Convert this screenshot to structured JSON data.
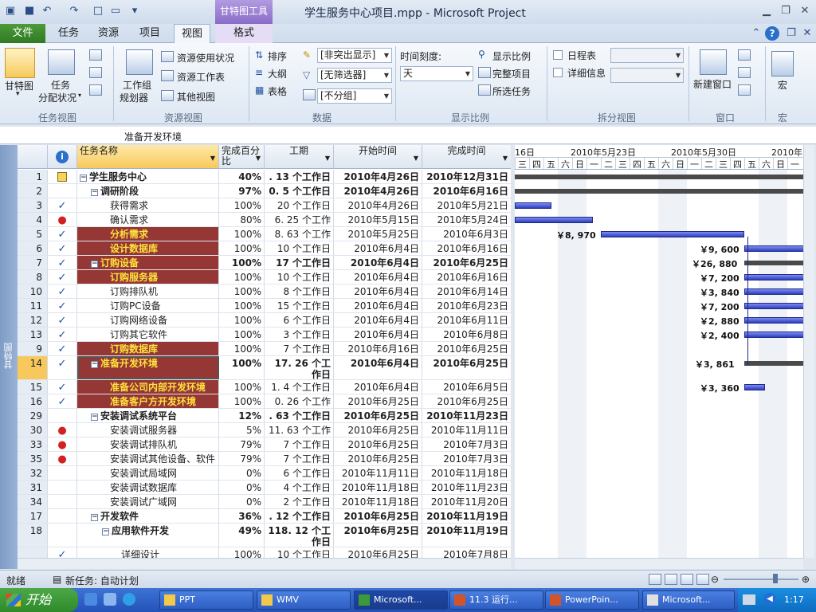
{
  "titlebar": {
    "title": "学生服务中心项目.mpp - Microsoft Project",
    "tool_tab_header": "甘特图工具"
  },
  "tabs": {
    "file": "文件",
    "items": [
      "任务",
      "资源",
      "项目",
      "视图",
      "格式"
    ],
    "active": "视图"
  },
  "ribbon": {
    "task_view": {
      "gantt": "甘特图",
      "task_usage_1": "任务",
      "task_usage_2": "分配状况",
      "group": "任务视图"
    },
    "resource_view": {
      "team_planner_1": "工作组",
      "team_planner_2": "规划器",
      "resource_usage": "资源使用状况",
      "resource_sheet": "资源工作表",
      "other_views": "其他视图",
      "group": "资源视图"
    },
    "data": {
      "sort": "排序",
      "outline": "大纲",
      "tables": "表格",
      "highlight": "[非突出显示]",
      "filter": "[无筛选器]",
      "group_by": "[不分组]",
      "group": "数据"
    },
    "zoom": {
      "timescale_label": "时间刻度:",
      "timescale_value": "天",
      "zoom": "显示比例",
      "entire_project": "完整项目",
      "selected_tasks": "所选任务",
      "group": "显示比例"
    },
    "split": {
      "timeline": "日程表",
      "details": "详细信息",
      "group": "拆分视图"
    },
    "window": {
      "new_window": "新建窗口",
      "group": "窗口"
    },
    "macros": {
      "macro": "宏",
      "group": "宏"
    }
  },
  "entry_bar": {
    "value": "准备开发环境"
  },
  "side_label": "甘特图",
  "table": {
    "headers": {
      "name": "任务名称",
      "pct": "完成百分比",
      "duration": "工期",
      "start": "开始时间",
      "finish": "完成时间"
    },
    "rows": [
      {
        "row": "1",
        "id": "1",
        "ind": "note",
        "name": "学生服务中心",
        "lvl": 0,
        "sum": true,
        "bold": true,
        "hl": false,
        "pct": "40%",
        "dur": ". 13 个工作日",
        "start": "2010年4月26日",
        "finish": "2010年12月31日"
      },
      {
        "row": "2",
        "id": "2",
        "ind": "",
        "name": "调研阶段",
        "lvl": 1,
        "sum": true,
        "bold": true,
        "hl": false,
        "pct": "97%",
        "dur": "0. 5 个工作日",
        "start": "2010年4月26日",
        "finish": "2010年6月16日"
      },
      {
        "row": "3",
        "id": "3",
        "ind": "check",
        "name": "获得需求",
        "lvl": 2,
        "sum": false,
        "bold": false,
        "hl": false,
        "pct": "100%",
        "dur": "20 个工作日",
        "start": "2010年4月26日",
        "finish": "2010年5月21日"
      },
      {
        "row": "4",
        "id": "4",
        "ind": "person",
        "name": "确认需求",
        "lvl": 2,
        "sum": false,
        "bold": false,
        "hl": false,
        "pct": "80%",
        "dur": "6. 25 个工作日",
        "start": "2010年5月15日",
        "finish": "2010年5月24日"
      },
      {
        "row": "5",
        "id": "5",
        "ind": "check",
        "name": "分析需求",
        "lvl": 2,
        "sum": false,
        "bold": false,
        "hl": true,
        "pct": "100%",
        "dur": "8. 63 个工作日",
        "start": "2010年5月25日",
        "finish": "2010年6月3日"
      },
      {
        "row": "6",
        "id": "6",
        "ind": "check",
        "name": "设计数据库",
        "lvl": 2,
        "sum": false,
        "bold": false,
        "hl": true,
        "pct": "100%",
        "dur": "10 个工作日",
        "start": "2010年6月4日",
        "finish": "2010年6月16日"
      },
      {
        "row": "7",
        "id": "7",
        "ind": "check",
        "name": "订购设备",
        "lvl": 1,
        "sum": true,
        "bold": true,
        "hl": true,
        "pct": "100%",
        "dur": "17 个工作日",
        "start": "2010年6月4日",
        "finish": "2010年6月25日"
      },
      {
        "row": "8",
        "id": "8",
        "ind": "check",
        "name": "订购服务器",
        "lvl": 2,
        "sum": false,
        "bold": false,
        "hl": true,
        "pct": "100%",
        "dur": "10 个工作日",
        "start": "2010年6月4日",
        "finish": "2010年6月16日"
      },
      {
        "row": "9",
        "id": "10",
        "ind": "check",
        "name": "订购排队机",
        "lvl": 2,
        "sum": false,
        "bold": false,
        "hl": false,
        "pct": "100%",
        "dur": "8 个工作日",
        "start": "2010年6月4日",
        "finish": "2010年6月14日"
      },
      {
        "row": "10",
        "id": "11",
        "ind": "check",
        "name": "订购PC设备",
        "lvl": 2,
        "sum": false,
        "bold": false,
        "hl": false,
        "pct": "100%",
        "dur": "15 个工作日",
        "start": "2010年6月4日",
        "finish": "2010年6月23日"
      },
      {
        "row": "11",
        "id": "12",
        "ind": "check",
        "name": "订购网络设备",
        "lvl": 2,
        "sum": false,
        "bold": false,
        "hl": false,
        "pct": "100%",
        "dur": "6 个工作日",
        "start": "2010年6月4日",
        "finish": "2010年6月11日"
      },
      {
        "row": "12",
        "id": "13",
        "ind": "check",
        "name": "订购其它软件",
        "lvl": 2,
        "sum": false,
        "bold": false,
        "hl": false,
        "pct": "100%",
        "dur": "3 个工作日",
        "start": "2010年6月4日",
        "finish": "2010年6月8日"
      },
      {
        "row": "13",
        "id": "9",
        "ind": "check",
        "name": "订购数据库",
        "lvl": 2,
        "sum": false,
        "bold": false,
        "hl": true,
        "pct": "100%",
        "dur": "7 个工作日",
        "start": "2010年6月16日",
        "finish": "2010年6月25日"
      },
      {
        "row": "14",
        "id": "14",
        "ind": "check",
        "name": "准备开发环境",
        "lvl": 1,
        "sum": true,
        "bold": true,
        "hl": true,
        "pct": "100%",
        "dur": "17. 26 个工作日",
        "start": "2010年6月4日",
        "finish": "2010年6月25日",
        "tall": true,
        "selected": true
      },
      {
        "row": "15",
        "id": "15",
        "ind": "check",
        "name": "准备公司内部开发环境",
        "lvl": 2,
        "sum": false,
        "bold": false,
        "hl": true,
        "pct": "100%",
        "dur": "1. 4 个工作日",
        "start": "2010年6月4日",
        "finish": "2010年6月5日"
      },
      {
        "row": "16",
        "id": "16",
        "ind": "check",
        "name": "准备客户方开发环境",
        "lvl": 2,
        "sum": false,
        "bold": false,
        "hl": true,
        "pct": "100%",
        "dur": "0. 26 个工作日",
        "start": "2010年6月25日",
        "finish": "2010年6月25日"
      },
      {
        "row": "17",
        "id": "29",
        "ind": "",
        "name": "安装调试系统平台",
        "lvl": 1,
        "sum": true,
        "bold": true,
        "hl": false,
        "pct": "12%",
        "dur": ". 63 个工作日",
        "start": "2010年6月25日",
        "finish": "2010年11月23日"
      },
      {
        "row": "18",
        "id": "30",
        "ind": "person",
        "name": "安装调试服务器",
        "lvl": 2,
        "sum": false,
        "bold": false,
        "hl": false,
        "pct": "5%",
        "dur": "11. 63 个工作日",
        "start": "2010年6月25日",
        "finish": "2010年11月11日"
      },
      {
        "row": "19",
        "id": "33",
        "ind": "person",
        "name": "安装调试排队机",
        "lvl": 2,
        "sum": false,
        "bold": false,
        "hl": false,
        "pct": "79%",
        "dur": "7 个工作日",
        "start": "2010年6月25日",
        "finish": "2010年7月3日"
      },
      {
        "row": "20",
        "id": "35",
        "ind": "person",
        "name": "安装调试其他设备、软件",
        "lvl": 2,
        "sum": false,
        "bold": false,
        "hl": false,
        "pct": "79%",
        "dur": "7 个工作日",
        "start": "2010年6月25日",
        "finish": "2010年7月3日"
      },
      {
        "row": "21",
        "id": "32",
        "ind": "",
        "name": "安装调试局域网",
        "lvl": 2,
        "sum": false,
        "bold": false,
        "hl": false,
        "pct": "0%",
        "dur": "6 个工作日",
        "start": "2010年11月11日",
        "finish": "2010年11月18日"
      },
      {
        "row": "22",
        "id": "31",
        "ind": "",
        "name": "安装调试数据库",
        "lvl": 2,
        "sum": false,
        "bold": false,
        "hl": false,
        "pct": "0%",
        "dur": "4 个工作日",
        "start": "2010年11月18日",
        "finish": "2010年11月23日"
      },
      {
        "row": "23",
        "id": "34",
        "ind": "",
        "name": "安装调试广域网",
        "lvl": 2,
        "sum": false,
        "bold": false,
        "hl": false,
        "pct": "0%",
        "dur": "2 个工作日",
        "start": "2010年11月18日",
        "finish": "2010年11月20日"
      },
      {
        "row": "24",
        "id": "17",
        "ind": "",
        "name": "开发软件",
        "lvl": 1,
        "sum": true,
        "bold": true,
        "hl": false,
        "pct": "36%",
        "dur": ". 12 个工作日",
        "start": "2010年6月25日",
        "finish": "2010年11月19日"
      },
      {
        "row": "25",
        "id": "18",
        "ind": "",
        "name": "应用软件开发",
        "lvl": 2,
        "sum": true,
        "bold": true,
        "hl": false,
        "pct": "49%",
        "dur": "118. 12 个工作日",
        "start": "2010年6月25日",
        "finish": "2010年11月19日",
        "tall": true
      },
      {
        "row": "26",
        "id": "",
        "ind": "check",
        "name": "详细设计",
        "lvl": 3,
        "sum": false,
        "bold": false,
        "hl": false,
        "pct": "100%",
        "dur": "10 个工作日",
        "start": "2010年6月25日",
        "finish": "2010年7月8日"
      }
    ]
  },
  "gantt": {
    "weeks": [
      "16日",
      "2010年5月23日",
      "2010年5月30日",
      "2010年"
    ],
    "days": [
      "三",
      "四",
      "五",
      "六",
      "日",
      "一",
      "二",
      "三",
      "四",
      "五",
      "六",
      "日",
      "一",
      "二",
      "三",
      "四",
      "五",
      "六",
      "日",
      "一"
    ],
    "costs": [
      "￥8, 970",
      "￥9, 600",
      "￥26, 880",
      "￥7, 200",
      "￥3, 840",
      "￥7, 200",
      "￥2, 880",
      "￥2, 400",
      "￥3, 861",
      "￥3, 360"
    ],
    "colors": {
      "bar": "#3a48c8",
      "summary": "#4a4a4a",
      "highlight_bg": "#953735",
      "highlight_fg": "#ffe23a"
    }
  },
  "statusbar": {
    "ready": "就绪",
    "new_tasks": "新任务: 自动计划"
  },
  "taskbar": {
    "start": "开始",
    "buttons": [
      "PPT",
      "WMV",
      "Microsoft...",
      "11.3 运行...",
      "PowerPoin...",
      "Microsoft..."
    ],
    "clock": "1:17"
  }
}
